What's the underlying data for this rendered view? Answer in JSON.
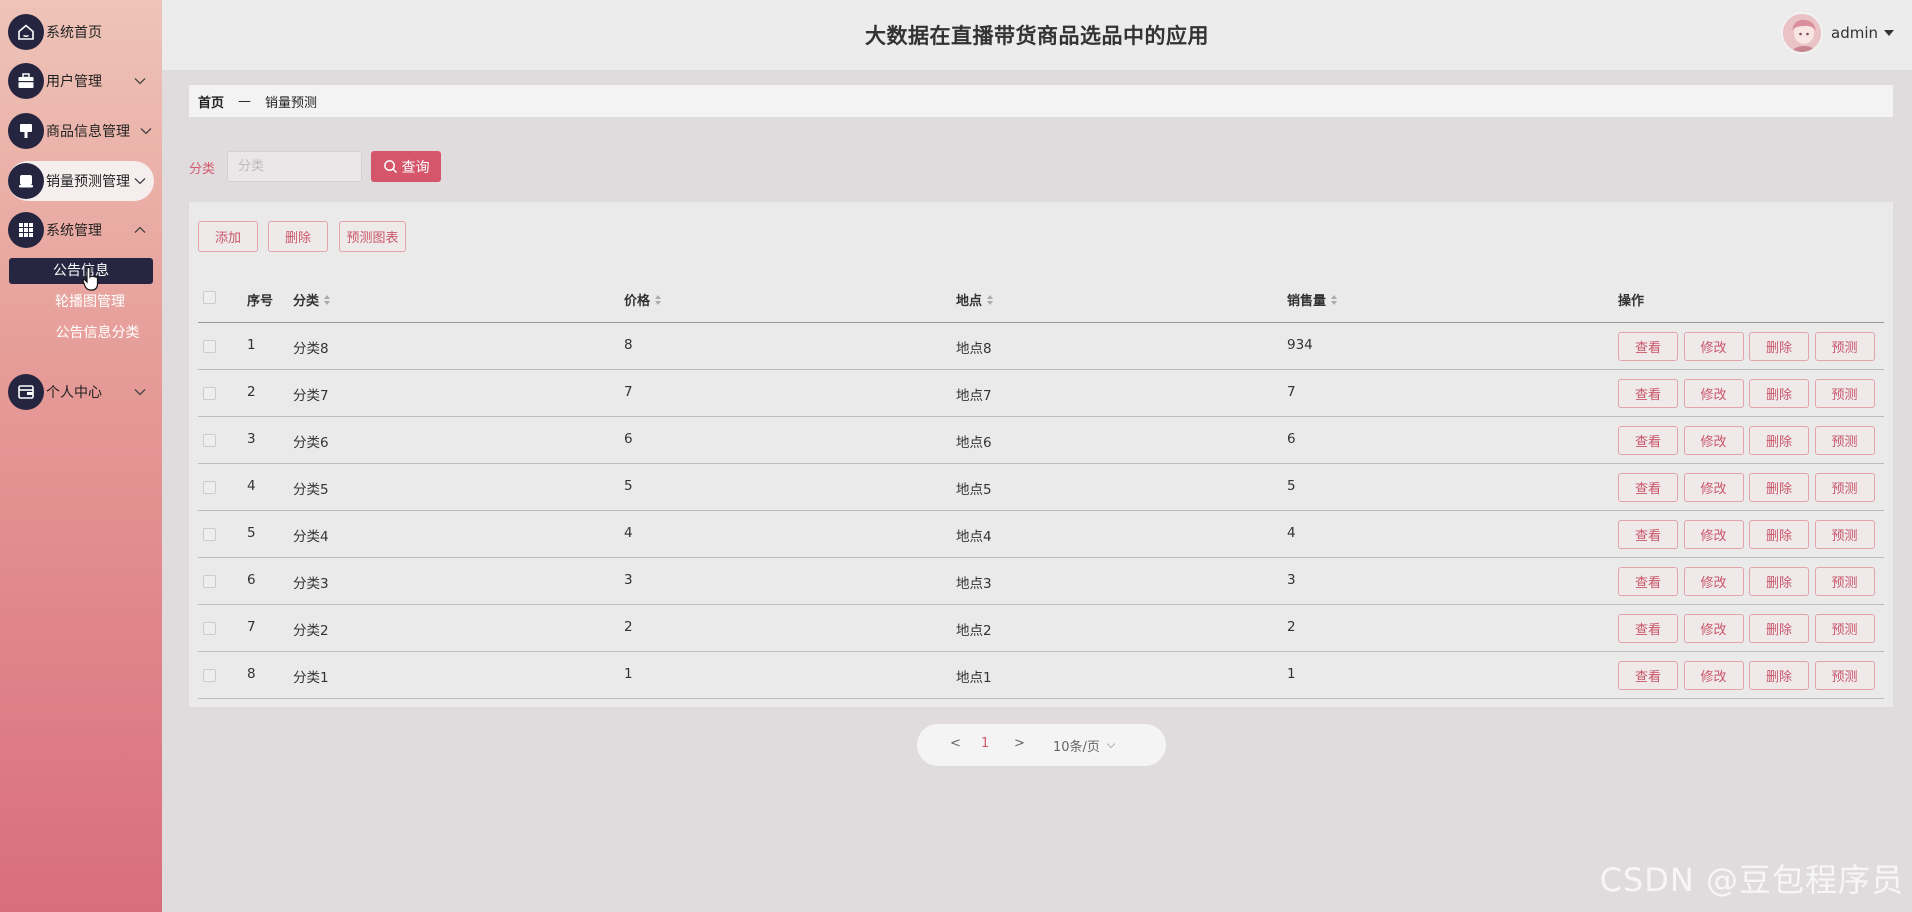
{
  "app": {
    "title": "大数据在直播带货商品选品中的应用"
  },
  "user": {
    "name": "admin"
  },
  "sidebar": {
    "items": [
      {
        "label": "系统首页",
        "icon": "home-icon"
      },
      {
        "label": "用户管理",
        "icon": "briefcase-icon"
      },
      {
        "label": "商品信息管理",
        "icon": "goods-icon"
      },
      {
        "label": "销量预测管理",
        "icon": "forecast-icon"
      },
      {
        "label": "系统管理",
        "icon": "grid-icon"
      },
      {
        "label": "个人中心",
        "icon": "wallet-icon"
      }
    ],
    "sub_items": [
      "公告信息",
      "轮播图管理",
      "公告信息分类"
    ]
  },
  "breadcrumb": {
    "home": "首页",
    "sep": "—",
    "current": "销量预测"
  },
  "search": {
    "label": "分类",
    "placeholder": "分类",
    "button": "查询"
  },
  "toolbar": {
    "add": "添加",
    "delete": "删除",
    "chart": "预测图表"
  },
  "table": {
    "headers": {
      "index": "序号",
      "category": "分类",
      "price": "价格",
      "location": "地点",
      "sales": "销售量",
      "actions": "操作"
    },
    "rows": [
      {
        "index": "1",
        "category": "分类8",
        "price": "8",
        "location": "地点8",
        "sales": "934"
      },
      {
        "index": "2",
        "category": "分类7",
        "price": "7",
        "location": "地点7",
        "sales": "7"
      },
      {
        "index": "3",
        "category": "分类6",
        "price": "6",
        "location": "地点6",
        "sales": "6"
      },
      {
        "index": "4",
        "category": "分类5",
        "price": "5",
        "location": "地点5",
        "sales": "5"
      },
      {
        "index": "5",
        "category": "分类4",
        "price": "4",
        "location": "地点4",
        "sales": "4"
      },
      {
        "index": "6",
        "category": "分类3",
        "price": "3",
        "location": "地点3",
        "sales": "3"
      },
      {
        "index": "7",
        "category": "分类2",
        "price": "2",
        "location": "地点2",
        "sales": "2"
      },
      {
        "index": "8",
        "category": "分类1",
        "price": "1",
        "location": "地点1",
        "sales": "1"
      }
    ],
    "row_actions": {
      "view": "查看",
      "edit": "修改",
      "delete": "删除",
      "predict": "预测"
    }
  },
  "pagination": {
    "prev": "<",
    "page": "1",
    "next": ">",
    "page_size": "10条/页"
  },
  "watermark": "CSDN @豆包程序员",
  "colors": {
    "accent": "#d5566a",
    "sidebar_dark": "#252540"
  }
}
